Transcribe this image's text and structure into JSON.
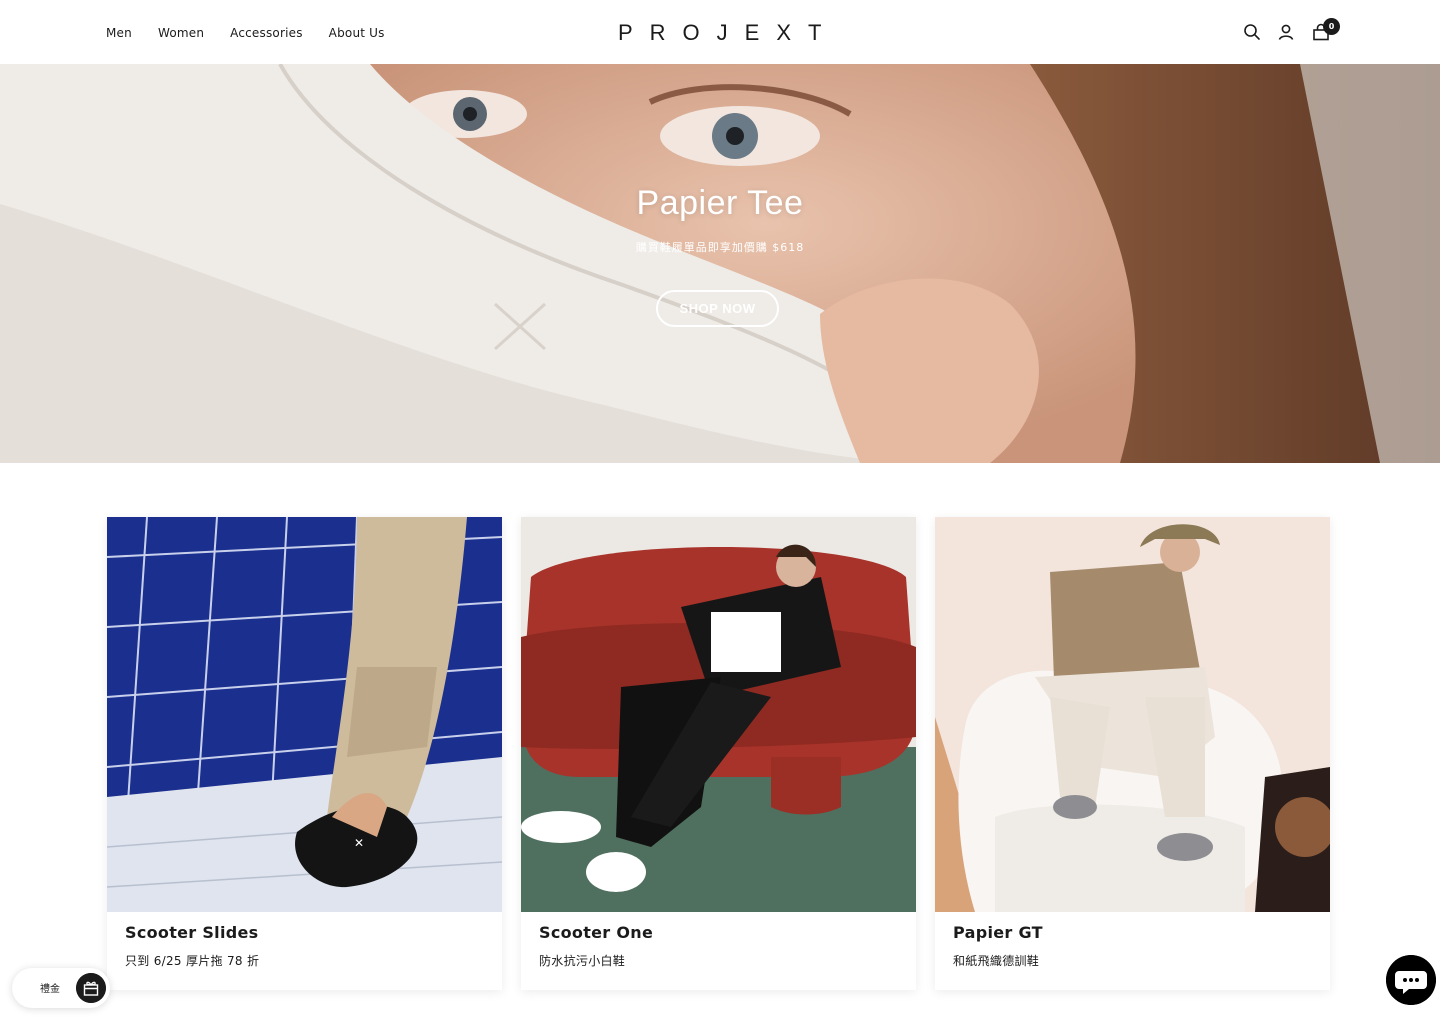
{
  "header": {
    "nav": [
      "Men",
      "Women",
      "Accessories",
      "About Us"
    ],
    "logo": "PROJEXT",
    "icons": [
      "search-icon",
      "account-icon",
      "cart-icon"
    ],
    "cart_count": "0"
  },
  "hero": {
    "title": "Papier Tee",
    "subtitle": "購買鞋履單品即享加價購 $618",
    "button": "SHOP NOW"
  },
  "products": [
    {
      "name": "Scooter Slides",
      "desc": "只到 6/25 厚片拖 78 折"
    },
    {
      "name": "Scooter One",
      "desc": "防水抗污小白鞋"
    },
    {
      "name": "Papier GT",
      "desc": "和紙飛織德訓鞋"
    }
  ],
  "gift_widget": {
    "label": "禮金",
    "icon": "gift-icon"
  },
  "chat": {
    "icon": "chat-icon"
  },
  "colors": {
    "text": "#1c1b1b",
    "background": "#ffffff",
    "tile_blue": "#1b2f8f",
    "sofa_red": "#a8332a"
  }
}
